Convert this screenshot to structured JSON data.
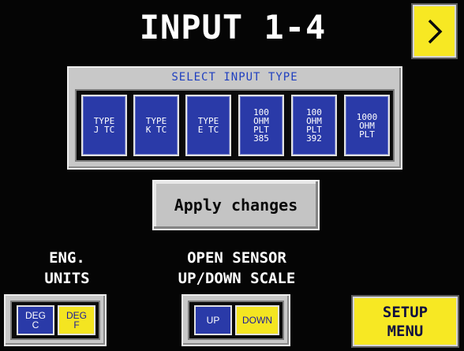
{
  "screen": {
    "title": "INPUT 1-4"
  },
  "nav": {
    "next_icon": "chevron-right-icon"
  },
  "input_type": {
    "title": "SELECT INPUT TYPE",
    "options": [
      {
        "label": "TYPE\nJ TC",
        "selected": true
      },
      {
        "label": "TYPE\nK TC",
        "selected": false
      },
      {
        "label": "TYPE\nE TC",
        "selected": false
      },
      {
        "label": "100\nOHM\nPLT\n385",
        "selected": false
      },
      {
        "label": "100\nOHM\nPLT\n392",
        "selected": false
      },
      {
        "label": "1000\nOHM\nPLT",
        "selected": false
      }
    ]
  },
  "apply": {
    "label": "Apply changes"
  },
  "eng_units": {
    "label": "ENG.\nUNITS",
    "options": [
      {
        "label": "DEG\nC",
        "state": "blue"
      },
      {
        "label": "DEG\nF",
        "state": "yellow"
      }
    ]
  },
  "open_sensor": {
    "label": "OPEN SENSOR\nUP/DOWN SCALE",
    "options": [
      {
        "label": "UP",
        "state": "blue"
      },
      {
        "label": "DOWN",
        "state": "yellow"
      }
    ]
  },
  "setup_menu": {
    "label": "SETUP\nMENU"
  },
  "colors": {
    "background": "#050505",
    "selected": "#f4e521",
    "unselected": "#2a3aa8",
    "panel": "#c8c8c8",
    "panel_title": "#1f3fbf"
  }
}
